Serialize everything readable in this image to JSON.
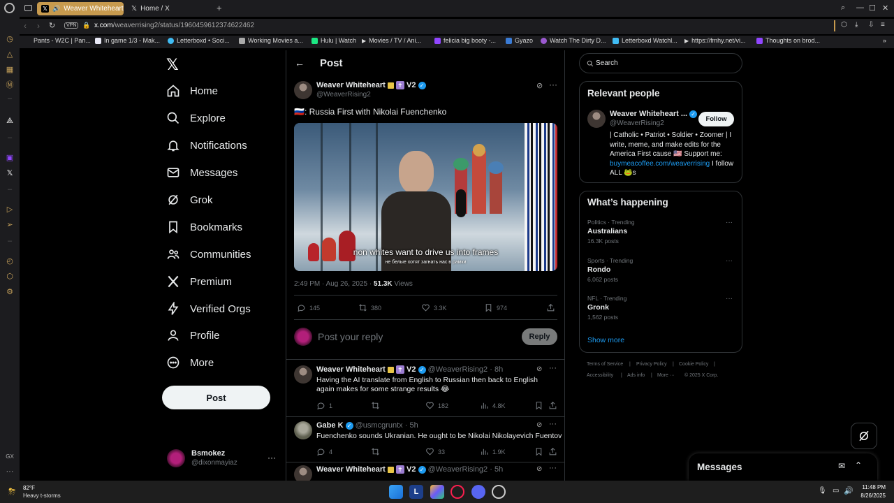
{
  "browser": {
    "tabs": [
      {
        "label": "Weaver Whiteheart",
        "active": true
      },
      {
        "label": "Home / X",
        "active": false
      }
    ],
    "url_host": "x.com",
    "url_path": "/weaverrising2/status/1960459612374622462",
    "vpn_label": "VPN",
    "bookmarks": [
      "Pants - W2C | Pan...",
      "In game 1/3 - Mak...",
      "Letterboxd • Soci...",
      "Working Movies a...",
      "Hulu | Watch",
      "Movies / TV / Ani...",
      "felicia big booty -...",
      "Gyazo",
      "Watch The Dirty D...",
      "Letterboxd Watchl...",
      "https://fmhy.net/vi...",
      "Thoughts on brod..."
    ]
  },
  "nav": {
    "items": [
      "Home",
      "Explore",
      "Notifications",
      "Messages",
      "Grok",
      "Bookmarks",
      "Communities",
      "Premium",
      "Verified Orgs",
      "Profile",
      "More"
    ],
    "post_label": "Post",
    "account_name": "Bsmokez",
    "account_handle": "@dixonmayiaz"
  },
  "main": {
    "header_title": "Post",
    "tweet": {
      "author": "Weaver Whiteheart",
      "badge": "V2",
      "handle": "@WeaverRising2",
      "text": "🇷🇺: Russia First with Nikolai Fuenchenko",
      "subtitle_en": "non whites want to drive us into frames",
      "subtitle_ru": "не белые хотят загнать нас в рамки",
      "timestamp": "2:49 PM · Aug 26, 2025 · ",
      "views_count": "51.3K",
      "views_label": " Views",
      "replies": "145",
      "reposts": "380",
      "likes": "3.3K",
      "bookmarks": "974"
    },
    "composer": {
      "placeholder": "Post your reply",
      "button": "Reply"
    },
    "replies": [
      {
        "author": "Weaver Whiteheart",
        "badge": "V2",
        "handle": "@WeaverRising2",
        "time": "· 8h",
        "text": "Having the AI translate from English to Russian then back to English again makes for some strange results 😂",
        "replies": "1",
        "likes": "182",
        "views": "4.8K"
      },
      {
        "author": "Gabe K",
        "handle": "@usmcgruntx",
        "time": "· 5h",
        "text": "Fuenchenko sounds Ukranian. He ought to be Nikolai Nikolayevich Fuentov",
        "replies": "4",
        "likes": "33",
        "views": "1.9K"
      },
      {
        "author": "Weaver Whiteheart",
        "badge": "V2",
        "handle": "@WeaverRising2",
        "time": "· 5h"
      }
    ]
  },
  "sidebar": {
    "search_placeholder": "Search",
    "relevant_title": "Relevant people",
    "person": {
      "name": "Weaver Whiteheart ...",
      "handle": "@WeaverRising2",
      "follow": "Follow",
      "bio": "| Catholic • Patriot • Soldier • Zoomer | I write, meme, and make edits for the America First cause 🇺🇸 Support me: ",
      "link": "buymeacoffee.com/weaverrising",
      "bio_end": " I follow ALL 🐸s"
    },
    "happening_title": "What’s happening",
    "trends": [
      {
        "context": "Politics · Trending",
        "name": "Australians",
        "posts": "16.3K posts"
      },
      {
        "context": "Sports · Trending",
        "name": "Rondo",
        "posts": "6,062 posts"
      },
      {
        "context": "NFL · Trending",
        "name": "Gronk",
        "posts": "1,562 posts"
      }
    ],
    "show_more": "Show more",
    "footer": [
      "Terms of Service",
      "Privacy Policy",
      "Cookie Policy",
      "Accessibility",
      "Ads info",
      "More ···",
      "© 2025 X Corp."
    ]
  },
  "messages_drawer": {
    "title": "Messages"
  },
  "taskbar": {
    "temp": "82°F",
    "weather": "Heavy t-storms",
    "time": "11:48 PM",
    "date": "8/26/2025"
  },
  "colors": {
    "accent": "#1d9bf0",
    "browser_tab": "#c79a4e",
    "background": "#000000"
  }
}
